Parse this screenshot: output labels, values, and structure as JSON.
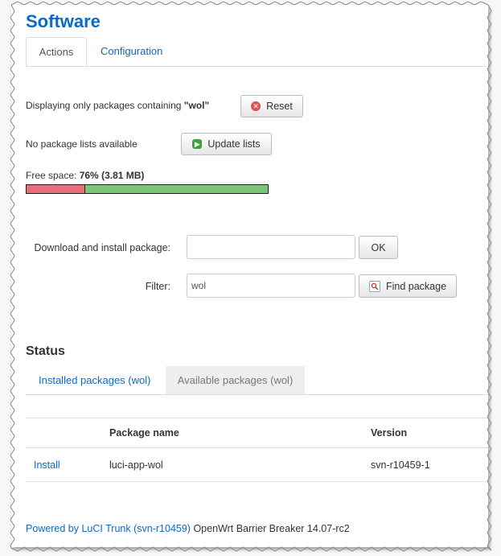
{
  "page_title": "Software",
  "tabs": {
    "actions": "Actions",
    "configuration": "Configuration"
  },
  "filter_notice": {
    "prefix": "Displaying only packages containing ",
    "term": "\"wol\"",
    "reset_label": "Reset"
  },
  "lists": {
    "message": "No package lists available",
    "update_label": "Update lists"
  },
  "free_space": {
    "label": "Free space: ",
    "percent": "76%",
    "size": "(3.81 MB)",
    "used_fraction": 0.24,
    "used_color": "#e66e78",
    "free_color": "#7cc47c"
  },
  "download": {
    "label": "Download and install package:",
    "value": "",
    "ok_label": "OK"
  },
  "filter": {
    "label": "Filter:",
    "value": "wol",
    "find_label": "Find package"
  },
  "status": {
    "heading": "Status",
    "tabs": {
      "installed": "Installed packages (wol)",
      "available": "Available packages (wol)"
    }
  },
  "table": {
    "headers": [
      "",
      "Package name",
      "Version"
    ],
    "rows": [
      {
        "action": "Install",
        "name": "luci-app-wol",
        "version": "svn-r10459-1"
      }
    ]
  },
  "footer": {
    "link": "Powered by LuCI Trunk (svn-r10459)",
    "text": " OpenWrt Barrier Breaker 14.07-rc2"
  },
  "colors": {
    "accent": "#0a6ac8"
  }
}
